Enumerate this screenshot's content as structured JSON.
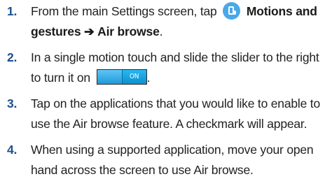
{
  "steps": [
    {
      "number": "1.",
      "text_before": "From the main Settings screen, tap",
      "icon": "motions-and-gestures-icon",
      "bold_path": "Motions and gestures",
      "arrow": "➔",
      "bold_target": "Air browse",
      "text_after": "."
    },
    {
      "number": "2.",
      "text": "In a single motion touch and slide the slider to the right to turn it on",
      "toggle": {
        "label": "ON",
        "state": "on",
        "color": "#1e9ad6"
      },
      "text_after": "."
    },
    {
      "number": "3.",
      "text": "Tap on the applications that you would like to enable to use the Air browse feature. A checkmark will appear."
    },
    {
      "number": "4.",
      "text": "When using a supported application, move your open hand across the screen to use Air browse."
    }
  ],
  "colors": {
    "step_number": "#1c4f8f",
    "icon_background": "#4aa8e8",
    "body_text": "#222222"
  }
}
